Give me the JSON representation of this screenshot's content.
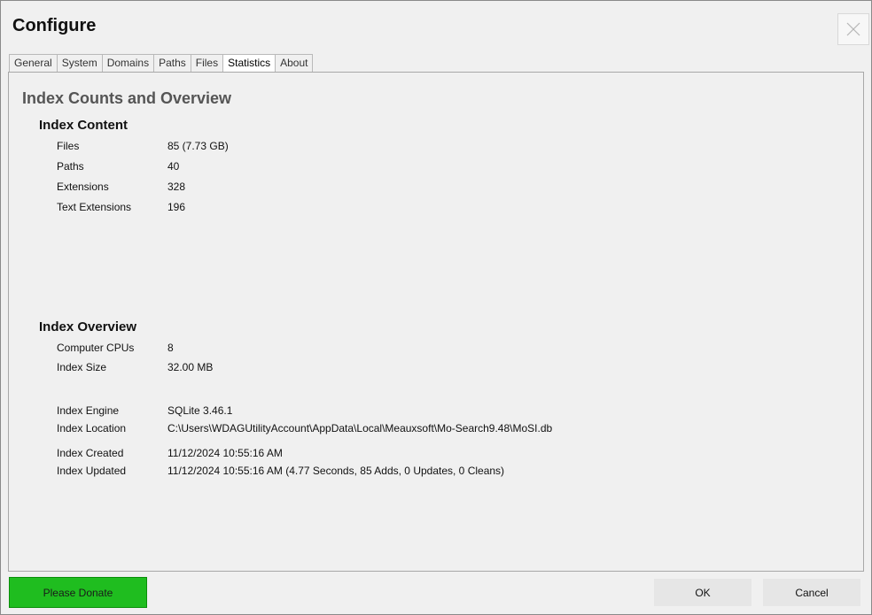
{
  "window": {
    "title": "Configure",
    "close_icon": "close-icon"
  },
  "tabs": [
    {
      "label": "General"
    },
    {
      "label": "System"
    },
    {
      "label": "Domains"
    },
    {
      "label": "Paths"
    },
    {
      "label": "Files"
    },
    {
      "label": "Statistics",
      "active": true
    },
    {
      "label": "About"
    }
  ],
  "statistics": {
    "heading": "Index Counts and Overview",
    "content": {
      "title": "Index Content",
      "rows": [
        {
          "label": "Files",
          "value": "85 (7.73 GB)"
        },
        {
          "label": "Paths",
          "value": "40"
        },
        {
          "label": "Extensions",
          "value": "328"
        },
        {
          "label": "Text Extensions",
          "value": "196"
        }
      ]
    },
    "overview": {
      "title": "Index Overview",
      "rows": [
        {
          "label": "Computer CPUs",
          "value": "8"
        },
        {
          "label": "Index Size",
          "value": "32.00 MB"
        },
        {
          "label": "Index Engine",
          "value": "SQLite 3.46.1"
        },
        {
          "label": "Index Location",
          "value": "C:\\Users\\WDAGUtilityAccount\\AppData\\Local\\Meauxsoft\\Mo-Search9.48\\MoSI.db"
        },
        {
          "label": "Index Created",
          "value": "11/12/2024 10:55:16 AM"
        },
        {
          "label": "Index Updated",
          "value": "11/12/2024 10:55:16 AM  (4.77 Seconds, 85 Adds, 0 Updates, 0 Cleans)"
        }
      ]
    }
  },
  "footer": {
    "donate_label": "Please Donate",
    "ok_label": "OK",
    "cancel_label": "Cancel"
  },
  "colors": {
    "donate_bg": "#1fbd1f",
    "heading_text": "#555555"
  }
}
